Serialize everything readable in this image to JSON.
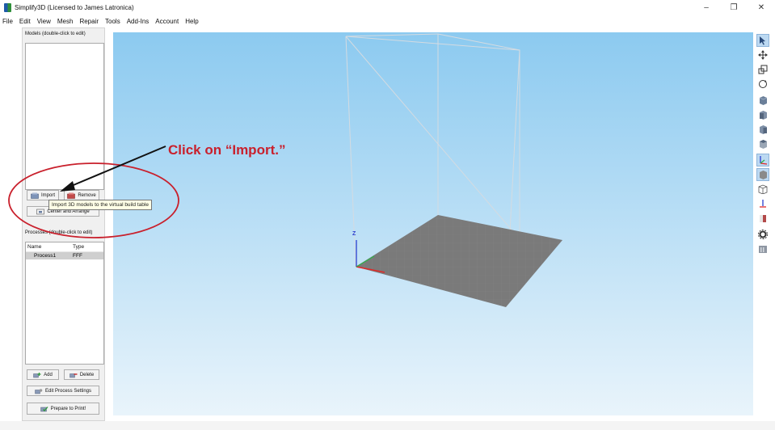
{
  "window": {
    "title": "Simplify3D (Licensed to James Latronica)",
    "controls": {
      "minimize": "–",
      "maximize": "❐",
      "close": "✕"
    }
  },
  "menu": [
    "File",
    "Edit",
    "View",
    "Mesh",
    "Repair",
    "Tools",
    "Add-Ins",
    "Account",
    "Help"
  ],
  "models_panel": {
    "label": "Models (double-click to edit)",
    "import_label": "Import",
    "remove_label": "Remove",
    "center_label": "Center and Arrange",
    "tooltip": "Import 3D models to the virtual build table"
  },
  "processes_panel": {
    "label": "Processes (double-click to edit)",
    "columns": [
      "Name",
      "Type"
    ],
    "rows": [
      {
        "name": "Process1",
        "type": "FFF"
      }
    ],
    "add_label": "Add",
    "delete_label": "Delete",
    "edit_label": "Edit Process Settings",
    "prepare_label": "Prepare to Print!"
  },
  "viewport": {
    "axis_z": "Z"
  },
  "annotation": {
    "text": "Click on “Import.”",
    "color": "#c9202c"
  },
  "toolbar": {
    "tools": [
      "select-cursor-icon",
      "move-icon",
      "scale-icon",
      "rotate-icon",
      "cube-view-iso-icon",
      "cube-view-front-icon",
      "cube-view-side-icon",
      "cube-view-top-icon",
      "axes-toggle-icon",
      "solid-view-icon",
      "wireframe-view-icon",
      "cross-section-icon",
      "bed-view-icon",
      "settings-gear-icon",
      "machine-icon"
    ]
  }
}
